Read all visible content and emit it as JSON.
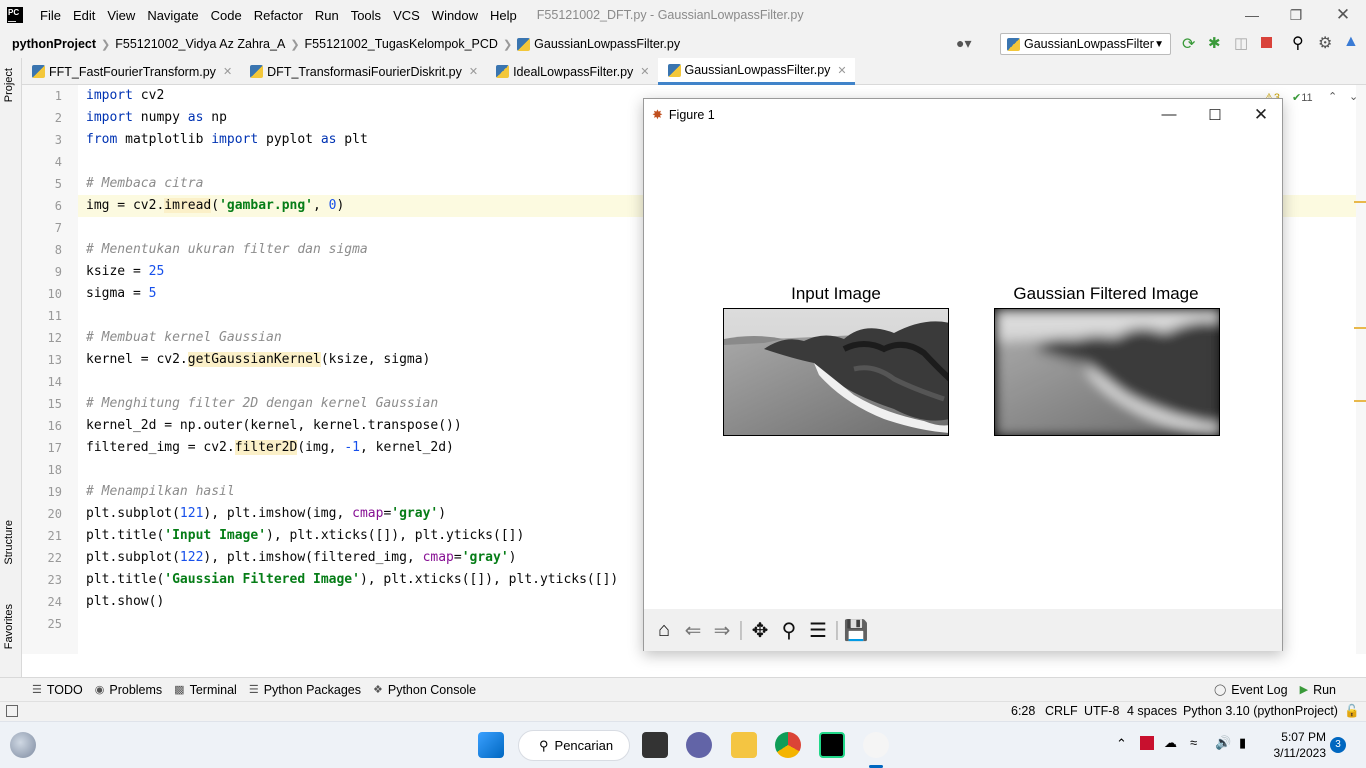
{
  "window": {
    "title": "F55121002_DFT.py - GaussianLowpassFilter.py",
    "menu": [
      "File",
      "Edit",
      "View",
      "Navigate",
      "Code",
      "Refactor",
      "Run",
      "Tools",
      "VCS",
      "Window",
      "Help"
    ]
  },
  "breadcrumb": [
    "pythonProject",
    "F55121002_Vidya Az Zahra_A",
    "F55121002_TugasKelompok_PCD",
    "GaussianLowpassFilter.py"
  ],
  "run_config": {
    "label": "GaussianLowpassFilter"
  },
  "tabs": [
    {
      "label": "FFT_FastFourierTransform.py"
    },
    {
      "label": "DFT_TransformasiFourierDiskrit.py"
    },
    {
      "label": "IdealLowpassFilter.py"
    },
    {
      "label": "GaussianLowpassFilter.py"
    }
  ],
  "side_panels": {
    "project": "Project",
    "structure": "Structure",
    "favorites": "Favorites"
  },
  "inspections": {
    "warnings": "3",
    "ok": "11"
  },
  "editor": {
    "line_numbers": [
      "1",
      "2",
      "3",
      "4",
      "5",
      "6",
      "7",
      "8",
      "9",
      "10",
      "11",
      "12",
      "13",
      "14",
      "15",
      "16",
      "17",
      "18",
      "19",
      "20",
      "21",
      "22",
      "23",
      "24",
      "25"
    ],
    "lines": [
      "import cv2",
      "import numpy as np",
      "from matplotlib import pyplot as plt",
      "",
      "# Membaca citra",
      "img = cv2.imread('gambar.png', 0)",
      "",
      "# Menentukan ukuran filter dan sigma",
      "ksize = 25",
      "sigma = 5",
      "",
      "# Membuat kernel Gaussian",
      "kernel = cv2.getGaussianKernel(ksize, sigma)",
      "",
      "# Menghitung filter 2D dengan kernel Gaussian",
      "kernel_2d = np.outer(kernel, kernel.transpose())",
      "filtered_img = cv2.filter2D(img, -1, kernel_2d)",
      "",
      "# Menampilkan hasil",
      "plt.subplot(121), plt.imshow(img, cmap='gray')",
      "plt.title('Input Image'), plt.xticks([]), plt.yticks([])",
      "plt.subplot(122), plt.imshow(filtered_img, cmap='gray')",
      "plt.title('Gaussian Filtered Image'), plt.xticks([]), plt.yticks([])",
      "plt.show()",
      ""
    ]
  },
  "figure": {
    "title": "Figure 1",
    "left_title": "Input Image",
    "right_title": "Gaussian Filtered Image"
  },
  "tool_windows": [
    "TODO",
    "Problems",
    "Terminal",
    "Python Packages",
    "Python Console"
  ],
  "tool_windows_right": [
    "Event Log",
    "Run"
  ],
  "status": {
    "position": "6:28",
    "line_sep": "CRLF",
    "encoding": "UTF-8",
    "indent": "4 spaces",
    "interpreter": "Python 3.10 (pythonProject)"
  },
  "taskbar": {
    "search": "Pencarian",
    "time": "5:07 PM",
    "date": "3/11/2023",
    "notifications": "3"
  },
  "colors": {
    "accent": "#4083c9",
    "keyword": "#0033b3",
    "string": "#067d17",
    "comment": "#8c8c8c",
    "number": "#1750eb"
  }
}
